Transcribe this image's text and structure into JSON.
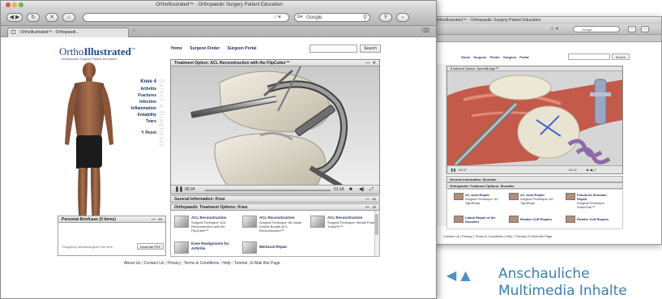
{
  "colors": {
    "brand_blue": "#1f4a8a",
    "link_navy": "#1a2c5a",
    "caption_blue": "#3b7fb4",
    "traffic_red": "#e3574f",
    "traffic_yellow": "#e7b43e",
    "traffic_green": "#69b64a"
  },
  "browser": {
    "window_title": "OrthoIllustrated™ - Orthopaedic Surgery Patient Education",
    "tab_label": "OrthoIllustrated™ - Orthopaedi...",
    "search_engine_label": "Google"
  },
  "page": {
    "logo_part1": "Ortho",
    "logo_part2": "Illustrated",
    "logo_trademark": "™",
    "tagline": "Orthopaedic Surgery Patient Education",
    "nav": [
      "Home",
      "Surgeon Finder",
      "Surgeon Portal"
    ],
    "search_button": "Search",
    "side_menu": {
      "heading": "Knee 4",
      "items": [
        "Arthritis",
        "Fractures",
        "Infection",
        "Inflammation",
        "Instability",
        "Tears"
      ],
      "reset": "↰ Reset"
    },
    "vertical_label": "Select a Diagnosis",
    "video_panel": {
      "title": "Treatment Option: ACL Reconstruction with the FlipCutter™",
      "time_elapsed": "00:24",
      "time_total": "01:18"
    },
    "general_info_bar": "General Information: Knee",
    "treatment_options_bar": "Orthopaedic Treatment Options: Knee",
    "options": [
      {
        "title": "ACL Reconstruction",
        "desc": "Surgical Technique: ACL Reconstruction with the FlipCutter™"
      },
      {
        "title": "ACL Reconstruction",
        "desc": "Surgical Technique: All-Inside Double Bundle ACL Reconstruction™"
      },
      {
        "title": "ACL Reconstruction",
        "desc": "Surgical Technique: Medial Portal TransFix™"
      },
      {
        "title": "Knee Realignment for Arthritis",
        "desc": ""
      },
      {
        "title": "Meniscal Repair",
        "desc": ""
      }
    ],
    "briefcase": {
      "title": "Personal Briefcase (0 Items)",
      "drag_hint": "Drag/drop media/surgeon info here",
      "generate_button": "Generate PDF"
    },
    "footer_links": [
      "About Us",
      "Contact Us",
      "Privacy",
      "Terms & Conditions",
      "Help",
      "Tutorial",
      "E-Mail this Page"
    ]
  },
  "back_window": {
    "window_title": "OrthoIllustrated™ - Orthopaedic Surgery Patient Education",
    "search_engine_label": "Google",
    "nav": [
      "Home",
      "Surgeon Finder",
      "Surgeon Portal"
    ],
    "search_button": "Search",
    "video_title": "Treatment Option: SpeedBridge™",
    "time_elapsed": "00:37",
    "time_total": "02:41",
    "general_info_bar": "General Information: Shoulder",
    "treatment_options_bar": "Orthopaedic Treatment Options: Shoulder",
    "options": [
      {
        "title": "AC Joint Repair",
        "desc": "Surgical Technique: AC TightRope"
      },
      {
        "title": "AC Joint Repair",
        "desc": "Surgical Technique: AC TightRope"
      },
      {
        "title": "Fractured Shoulder Repair",
        "desc": "Surgical Technique: SutureTak™"
      },
      {
        "title": "Labral Repair of the Shoulder",
        "desc": ""
      },
      {
        "title": "Rotator Cuff Repairs",
        "desc": ""
      },
      {
        "title": "Rotator Cuff Repairs",
        "desc": ""
      }
    ],
    "footer": "Contact Us  |  Privacy  |  Terms & Conditions  |  Help  |  Tutorial  |  E-Mail this Page"
  },
  "caption": {
    "arrows": "◀ ▲",
    "line1": "Anschauliche",
    "line2": "Multimedia Inhalte"
  }
}
